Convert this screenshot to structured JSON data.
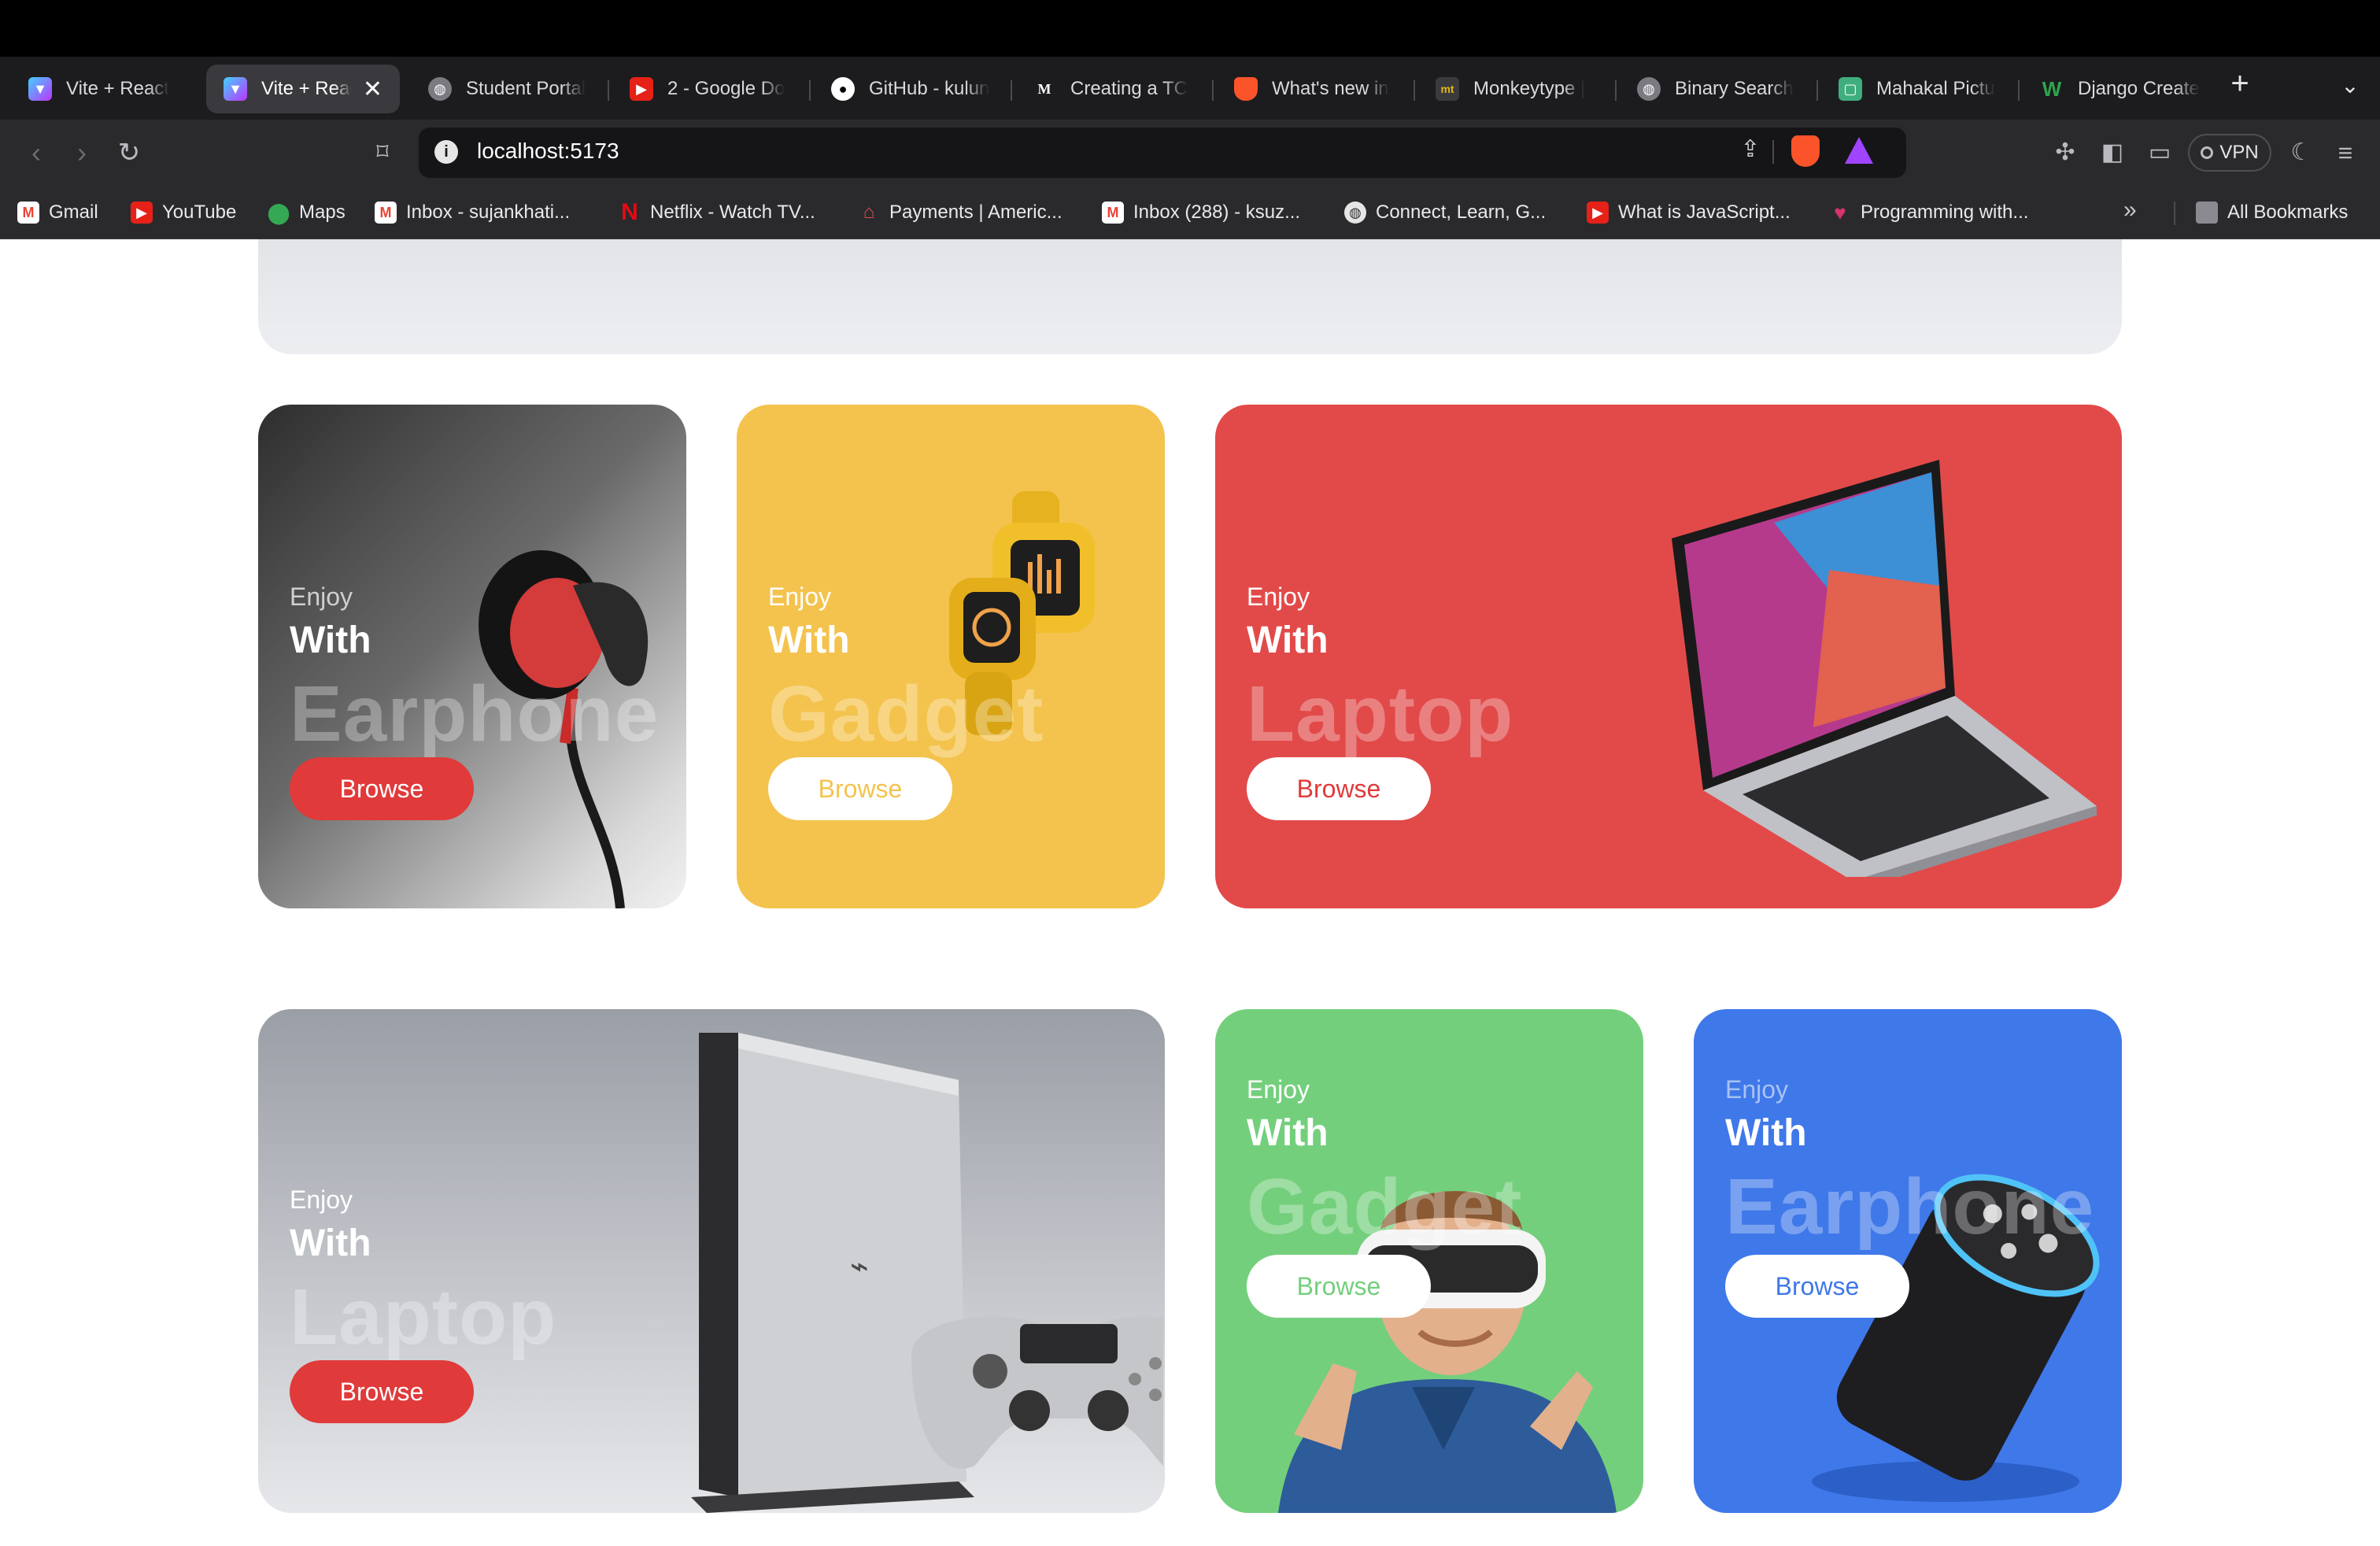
{
  "browser": {
    "tabs": [
      {
        "title": "Vite + React",
        "favicon": "vite-icon"
      },
      {
        "title": "Vite + React",
        "favicon": "vite-icon",
        "active": true
      },
      {
        "title": "Student Portal",
        "favicon": "globe-icon"
      },
      {
        "title": "2 - Google Do",
        "favicon": "youtube-icon"
      },
      {
        "title": "GitHub - kulun",
        "favicon": "github-icon"
      },
      {
        "title": "Creating a TC",
        "favicon": "medium-icon"
      },
      {
        "title": "What's new in",
        "favicon": "brave-icon"
      },
      {
        "title": "Monkeytype |",
        "favicon": "monkeytype-icon"
      },
      {
        "title": "Binary Search",
        "favicon": "globe-icon"
      },
      {
        "title": "Mahakal Pictu",
        "favicon": "page-icon"
      },
      {
        "title": "Django Create",
        "favicon": "w-icon"
      }
    ],
    "new_tab_glyph": "+",
    "url": "localhost:5173",
    "vpn_label": "VPN",
    "bookmarks": [
      {
        "label": "Gmail",
        "icon": "gmail-icon"
      },
      {
        "label": "YouTube",
        "icon": "youtube-icon"
      },
      {
        "label": "Maps",
        "icon": "maps-icon"
      },
      {
        "label": "Inbox - sujankhati...",
        "icon": "gmail-icon"
      },
      {
        "label": "Netflix - Watch TV...",
        "icon": "netflix-icon"
      },
      {
        "label": "Payments | Americ...",
        "icon": "payments-icon"
      },
      {
        "label": "Inbox (288) - ksuz...",
        "icon": "gmail-icon"
      },
      {
        "label": "Connect, Learn, G...",
        "icon": "globe-icon"
      },
      {
        "label": "What is JavaScript...",
        "icon": "youtube-icon"
      },
      {
        "label": "Programming with...",
        "icon": "heart-icon"
      }
    ],
    "more_bookmarks_glyph": "»",
    "all_bookmarks_label": "All Bookmarks"
  },
  "categories": [
    {
      "enjoy": "Enjoy",
      "with": "With",
      "title": "Earphone",
      "button": "Browse",
      "bg": "#3a3a3a",
      "product": "earphone"
    },
    {
      "enjoy": "Enjoy",
      "with": "With",
      "title": "Gadget",
      "button": "Browse",
      "bg": "#f4c34d",
      "product": "smartwatch"
    },
    {
      "enjoy": "Enjoy",
      "with": "With",
      "title": "Laptop",
      "button": "Browse",
      "bg": "#e24a4a",
      "product": "laptop"
    },
    {
      "enjoy": "Enjoy",
      "with": "With",
      "title": "Laptop",
      "button": "Browse",
      "bg": "#9a9ea6",
      "product": "game-console"
    },
    {
      "enjoy": "Enjoy",
      "with": "With",
      "title": "Gadget",
      "button": "Browse",
      "bg": "#74cf7c",
      "product": "vr-headset"
    },
    {
      "enjoy": "Enjoy",
      "with": "With",
      "title": "Earphone",
      "button": "Browse",
      "bg": "#3f78e9",
      "product": "smart-speaker"
    }
  ],
  "colors": {
    "accent_red": "#e03a3a",
    "yellow": "#f4c34d",
    "green": "#74cf7c",
    "blue": "#3f78e9"
  }
}
